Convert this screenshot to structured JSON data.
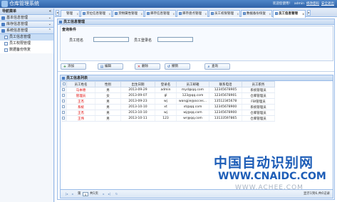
{
  "app": {
    "title": "仓库管理系统",
    "user": "admin",
    "top_links": [
      "欢迎您使用！",
      "admin",
      "修改密码",
      "安全退出"
    ]
  },
  "sidebar": {
    "title": "导航菜单",
    "groups": [
      {
        "label": "基本信息管理"
      },
      {
        "label": "库存信息管理"
      },
      {
        "label": "系统信息管理",
        "items": [
          "员工信息管理",
          "员工权限管理",
          "数据备份恢复"
        ],
        "active": 0
      }
    ]
  },
  "tabs": [
    {
      "label": "管理"
    },
    {
      "label": "货位信息管理"
    },
    {
      "label": "货物属性管理"
    },
    {
      "label": "库存信息管理"
    },
    {
      "label": "库存盘点管理"
    },
    {
      "label": "员工权限管理"
    },
    {
      "label": "数据备份恢复"
    },
    {
      "label": "员工信息管理",
      "active": true
    }
  ],
  "panel": {
    "title": "员工信息管理"
  },
  "search": {
    "legend": "查询条件",
    "name_label": "员工姓名",
    "login_label": "员工登录名",
    "name_value": "",
    "login_value": ""
  },
  "toolbar": {
    "add": "添加",
    "edit": "编辑",
    "delete": "删除",
    "cancel": "撤销",
    "query": "查询"
  },
  "grid": {
    "title": "员工信息列表",
    "columns": [
      "",
      "员工姓名",
      "性别",
      "出生日期",
      "登录名",
      "员工邮箱",
      "联系电话",
      "员工职务"
    ],
    "rows": [
      [
        "1",
        "马本德",
        "男",
        "2013-09-29",
        "admin",
        "myd@qq.com",
        "12345678905",
        "系统管理员"
      ],
      [
        "2",
        "管理员",
        "女",
        "2013-09-07",
        "gl",
        "123@qq.com",
        "12345678901",
        "仓库管理员"
      ],
      [
        "3",
        "王杰",
        "男",
        "2013-09-23",
        "wj",
        "wangjie@acces...",
        "13512345678",
        "FBI管理员"
      ],
      [
        "4",
        "系统",
        "男",
        "2013-10-10",
        "xt",
        "xt@qq.com",
        "12345678900",
        "系统管理员"
      ],
      [
        "5",
        "王杰",
        "男",
        "2013-10-10",
        "wj",
        "wj@qq.com",
        "12345678900",
        "仓库管理员"
      ],
      [
        "6",
        "王伟",
        "男",
        "2013-10-11",
        "123",
        "wr@qq.com",
        "13133597865",
        "仓库管理员"
      ]
    ]
  },
  "pager": {
    "page_label_before": "第",
    "page_value": "1",
    "page_label_after": "共1页",
    "info": "显示1到6,共6记录"
  },
  "watermark": {
    "cn": "中国自动识别网",
    "en": "WWW.CNAIDC.COM",
    "en2": "WWW.ACHEE.COM"
  }
}
